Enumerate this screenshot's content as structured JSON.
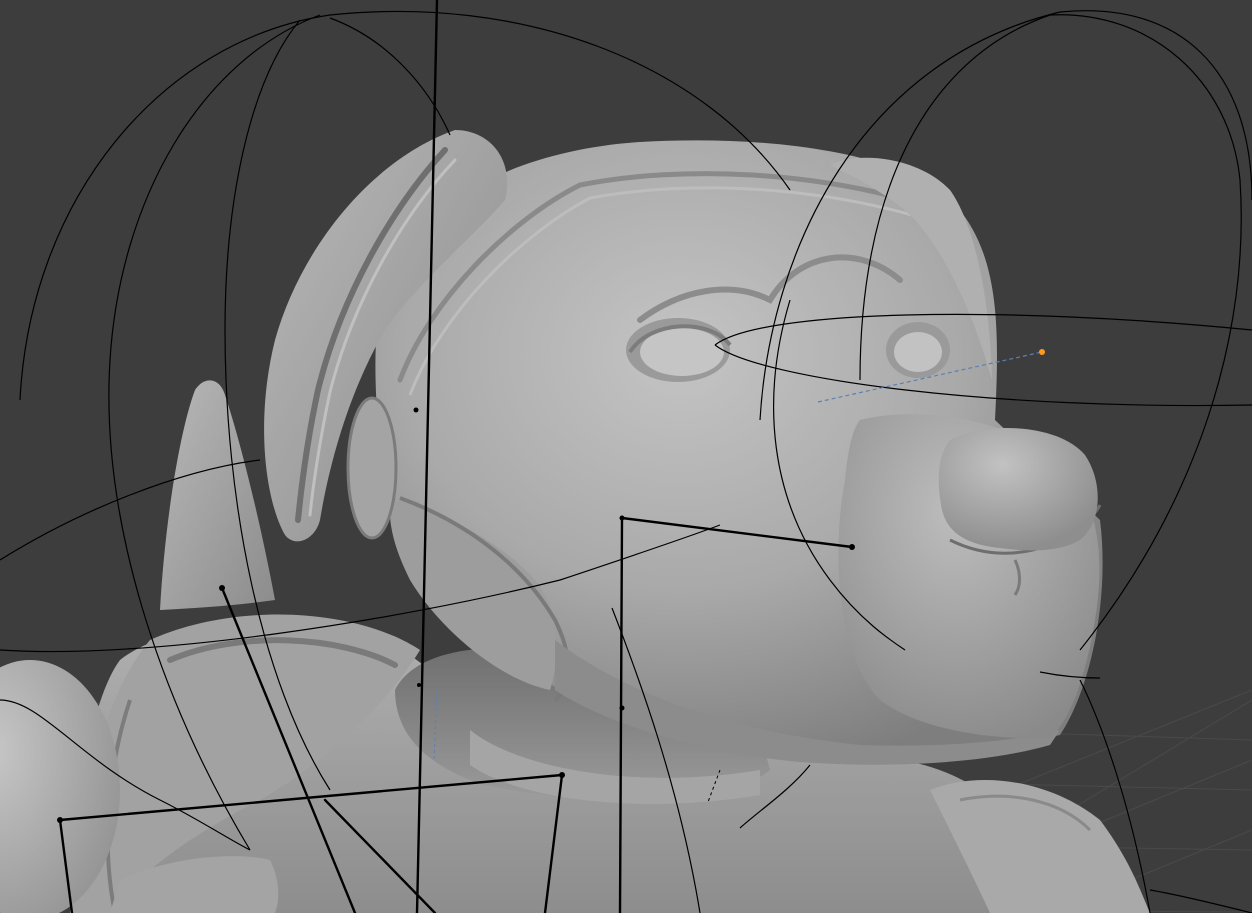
{
  "viewport": {
    "background_color": "#3d3d3d",
    "grid_color": "#4a4a4a",
    "model": {
      "name": "robot-dog",
      "shading": "solid",
      "base_color": "#a6a6a6"
    },
    "rig": {
      "wire_color": "#000000",
      "bone_color": "#000000",
      "light_color": "#ff9a1f",
      "light_dash_color": "#5f7fb0"
    }
  }
}
